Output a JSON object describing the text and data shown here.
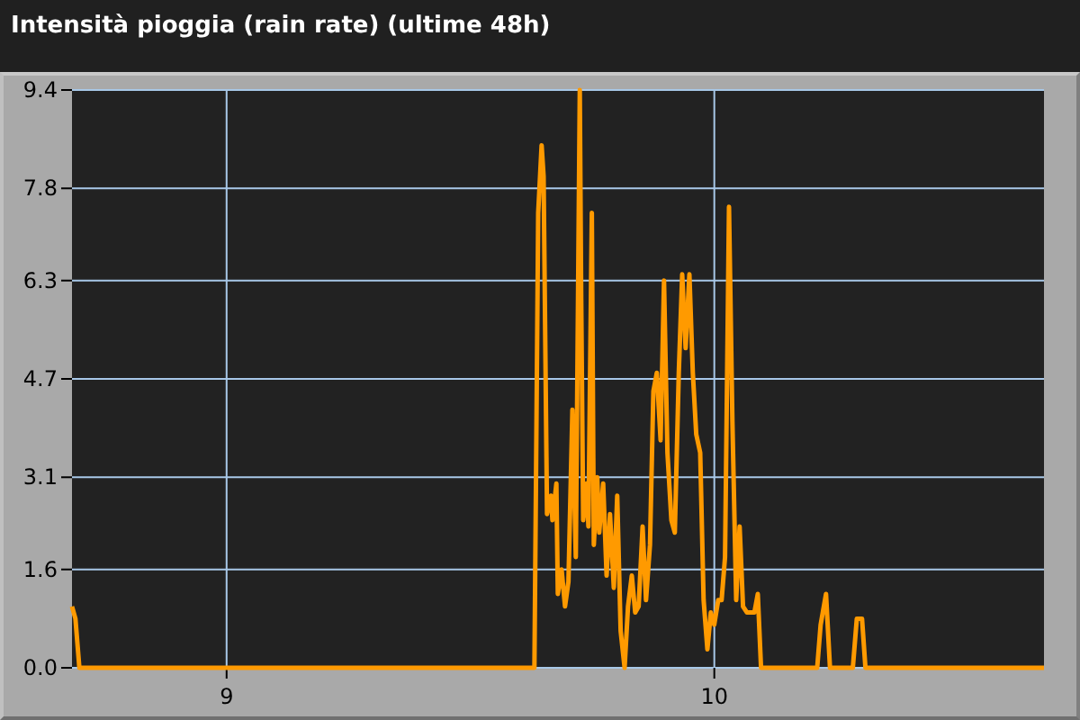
{
  "title": "Intensità pioggia (rain rate) (ultime 48h)",
  "chart": {
    "chart_data": {
      "type": "line",
      "xlim": [
        8.683,
        10.676
      ],
      "ylim": [
        0,
        9.4
      ],
      "grid": true,
      "xticks": [
        9,
        10
      ],
      "yticks": [
        {
          "value": 0,
          "label": "0.0"
        },
        {
          "value": 1.6,
          "label": "1.6"
        },
        {
          "value": 3.1,
          "label": "3.1"
        },
        {
          "value": 4.7,
          "label": "4.7"
        },
        {
          "value": 6.3,
          "label": "6.3"
        },
        {
          "value": 7.8,
          "label": "7.8"
        },
        {
          "value": 9.4,
          "label": "9.4"
        }
      ],
      "x": [
        8.683,
        8.69,
        8.698,
        9.631,
        9.635,
        9.639,
        9.646,
        9.65,
        9.657,
        9.665,
        9.668,
        9.676,
        9.679,
        9.687,
        9.694,
        9.701,
        9.709,
        9.716,
        9.724,
        9.727,
        9.731,
        9.738,
        9.742,
        9.749,
        9.753,
        9.76,
        9.764,
        9.772,
        9.779,
        9.786,
        9.794,
        9.801,
        9.808,
        9.816,
        9.823,
        9.831,
        9.838,
        9.845,
        9.853,
        9.86,
        9.868,
        9.875,
        9.882,
        9.89,
        9.897,
        9.904,
        9.912,
        9.919,
        9.927,
        9.934,
        9.941,
        9.949,
        9.956,
        9.963,
        9.971,
        9.978,
        9.986,
        9.993,
        10.0,
        10.008,
        10.015,
        10.022,
        10.03,
        10.037,
        10.045,
        10.052,
        10.059,
        10.067,
        10.082,
        10.089,
        10.096,
        10.211,
        10.218,
        10.229,
        10.237,
        10.284,
        10.292,
        10.303,
        10.31,
        10.676
      ],
      "series": [
        {
          "color": "#ff9a00",
          "values": [
            1.0,
            0.8,
            0,
            0,
            3.5,
            7.4,
            8.5,
            8.0,
            2.5,
            2.8,
            2.4,
            3.0,
            1.2,
            1.6,
            1.0,
            1.4,
            4.2,
            1.8,
            9.4,
            6.0,
            2.4,
            3.0,
            2.3,
            7.4,
            2.0,
            3.1,
            2.2,
            3.0,
            1.5,
            2.5,
            1.3,
            2.8,
            0.6,
            0,
            1.0,
            1.5,
            0.9,
            1.0,
            2.3,
            1.1,
            2.0,
            4.5,
            4.8,
            3.7,
            6.3,
            3.5,
            2.4,
            2.2,
            4.8,
            6.4,
            5.2,
            6.4,
            4.8,
            3.8,
            3.5,
            1.1,
            0.3,
            0.9,
            0.7,
            1.1,
            1.1,
            1.8,
            7.5,
            4.0,
            1.1,
            2.3,
            1.0,
            0.9,
            0.9,
            1.2,
            0,
            0,
            0.7,
            1.2,
            0,
            0,
            0.8,
            0.8,
            0,
            0
          ]
        }
      ]
    }
  }
}
